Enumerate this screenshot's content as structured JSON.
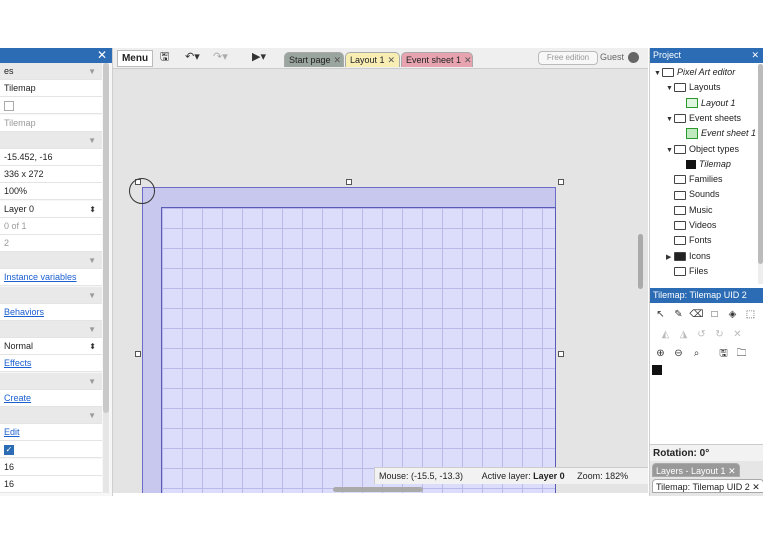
{
  "left_panel": {
    "rows": [
      {
        "text": "es",
        "kind": "cat"
      },
      {
        "text": "Tilemap",
        "kind": "value"
      },
      {
        "text": "",
        "kind": "checkbox"
      },
      {
        "text": "Tilemap",
        "kind": "gray"
      },
      {
        "text": "",
        "kind": "cat"
      },
      {
        "text": "-15.452, -16",
        "kind": "value"
      },
      {
        "text": "336 x 272",
        "kind": "value"
      },
      {
        "text": "100%",
        "kind": "value"
      },
      {
        "text": "Layer 0",
        "kind": "select"
      },
      {
        "text": "0 of 1",
        "kind": "gray"
      },
      {
        "text": "2",
        "kind": "gray"
      },
      {
        "text": "",
        "kind": "cat"
      },
      {
        "text": "Instance variables",
        "kind": "link"
      },
      {
        "text": "",
        "kind": "cat"
      },
      {
        "text": "Behaviors",
        "kind": "link"
      },
      {
        "text": "",
        "kind": "cat"
      },
      {
        "text": "Normal",
        "kind": "select"
      },
      {
        "text": "Effects",
        "kind": "link"
      },
      {
        "text": "",
        "kind": "cat"
      },
      {
        "text": "Create",
        "kind": "link"
      },
      {
        "text": "",
        "kind": "cat"
      },
      {
        "text": "Edit",
        "kind": "link"
      },
      {
        "text": "",
        "kind": "checked"
      },
      {
        "text": "16",
        "kind": "value"
      },
      {
        "text": "16",
        "kind": "value"
      }
    ],
    "close_glyph": "✕"
  },
  "toolbar": {
    "menu_label": "Menu",
    "tabs": [
      {
        "label": "Start page",
        "close": "✕"
      },
      {
        "label": "Layout 1",
        "close": "✕"
      },
      {
        "label": "Event sheet 1",
        "close": "✕"
      }
    ],
    "free_edition": "Free edition",
    "guest": "Guest"
  },
  "status_bar": {
    "mouse": "Mouse: (-15.5, -13.3)",
    "active_layer_label": "Active layer:",
    "active_layer_value": "Layer 0",
    "zoom": "Zoom: 182%"
  },
  "project_panel": {
    "title": "Project",
    "close_glyph": "✕",
    "tree": [
      {
        "label": "Pixel Art editor",
        "depth": 0,
        "icon": "folder",
        "toggle": "▼",
        "italic": true
      },
      {
        "label": "Layouts",
        "depth": 1,
        "icon": "folder",
        "toggle": "▼",
        "italic": false
      },
      {
        "label": "Layout 1",
        "depth": 2,
        "icon": "layout",
        "toggle": "",
        "italic": true
      },
      {
        "label": "Event sheets",
        "depth": 1,
        "icon": "folder",
        "toggle": "▼",
        "italic": false
      },
      {
        "label": "Event sheet 1",
        "depth": 2,
        "icon": "eventsheet",
        "toggle": "",
        "italic": true
      },
      {
        "label": "Object types",
        "depth": 1,
        "icon": "folder",
        "toggle": "▼",
        "italic": false
      },
      {
        "label": "Tilemap",
        "depth": 2,
        "icon": "tilemap",
        "toggle": "",
        "italic": true
      },
      {
        "label": "Families",
        "depth": 1,
        "icon": "folder",
        "toggle": "",
        "italic": false
      },
      {
        "label": "Sounds",
        "depth": 1,
        "icon": "folder",
        "toggle": "",
        "italic": false
      },
      {
        "label": "Music",
        "depth": 1,
        "icon": "folder",
        "toggle": "",
        "italic": false
      },
      {
        "label": "Videos",
        "depth": 1,
        "icon": "folder",
        "toggle": "",
        "italic": false
      },
      {
        "label": "Fonts",
        "depth": 1,
        "icon": "folder",
        "toggle": "",
        "italic": false
      },
      {
        "label": "Icons",
        "depth": 1,
        "icon": "folder-dark",
        "toggle": "▶",
        "italic": false
      },
      {
        "label": "Files",
        "depth": 1,
        "icon": "folder",
        "toggle": "",
        "italic": false
      }
    ]
  },
  "tilemap_panel": {
    "title": "Tilemap: Tilemap UID 2",
    "close_glyph": "✕",
    "rotation": "Rotation: 0°",
    "tab_layers": "Layers - Layout 1",
    "tab_layers_close": "✕",
    "tab_tilemap": "Tilemap: Tilemap UID 2",
    "tab_tilemap_close": "✕"
  }
}
